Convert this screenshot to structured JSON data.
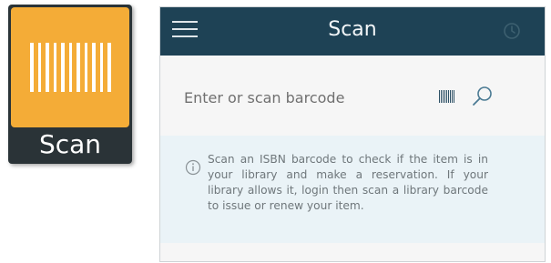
{
  "launcher": {
    "label": "Scan",
    "icon": "barcode-icon",
    "colors": {
      "tile": "#f4ac37",
      "frame": "#2a3337"
    }
  },
  "app": {
    "header": {
      "title": "Scan",
      "menu_icon": "hamburger-icon",
      "history_icon": "history-icon",
      "background": "#1e4255"
    },
    "search": {
      "placeholder": "Enter or scan barcode",
      "value": "",
      "barcode_icon": "barcode-icon",
      "search_icon": "search-icon"
    },
    "info": {
      "icon": "info-icon",
      "text": "Scan an ISBN barcode to check if the item is in your library and make a reservation. If your library allows it, login then scan a library barcode to issue or renew your item."
    }
  }
}
